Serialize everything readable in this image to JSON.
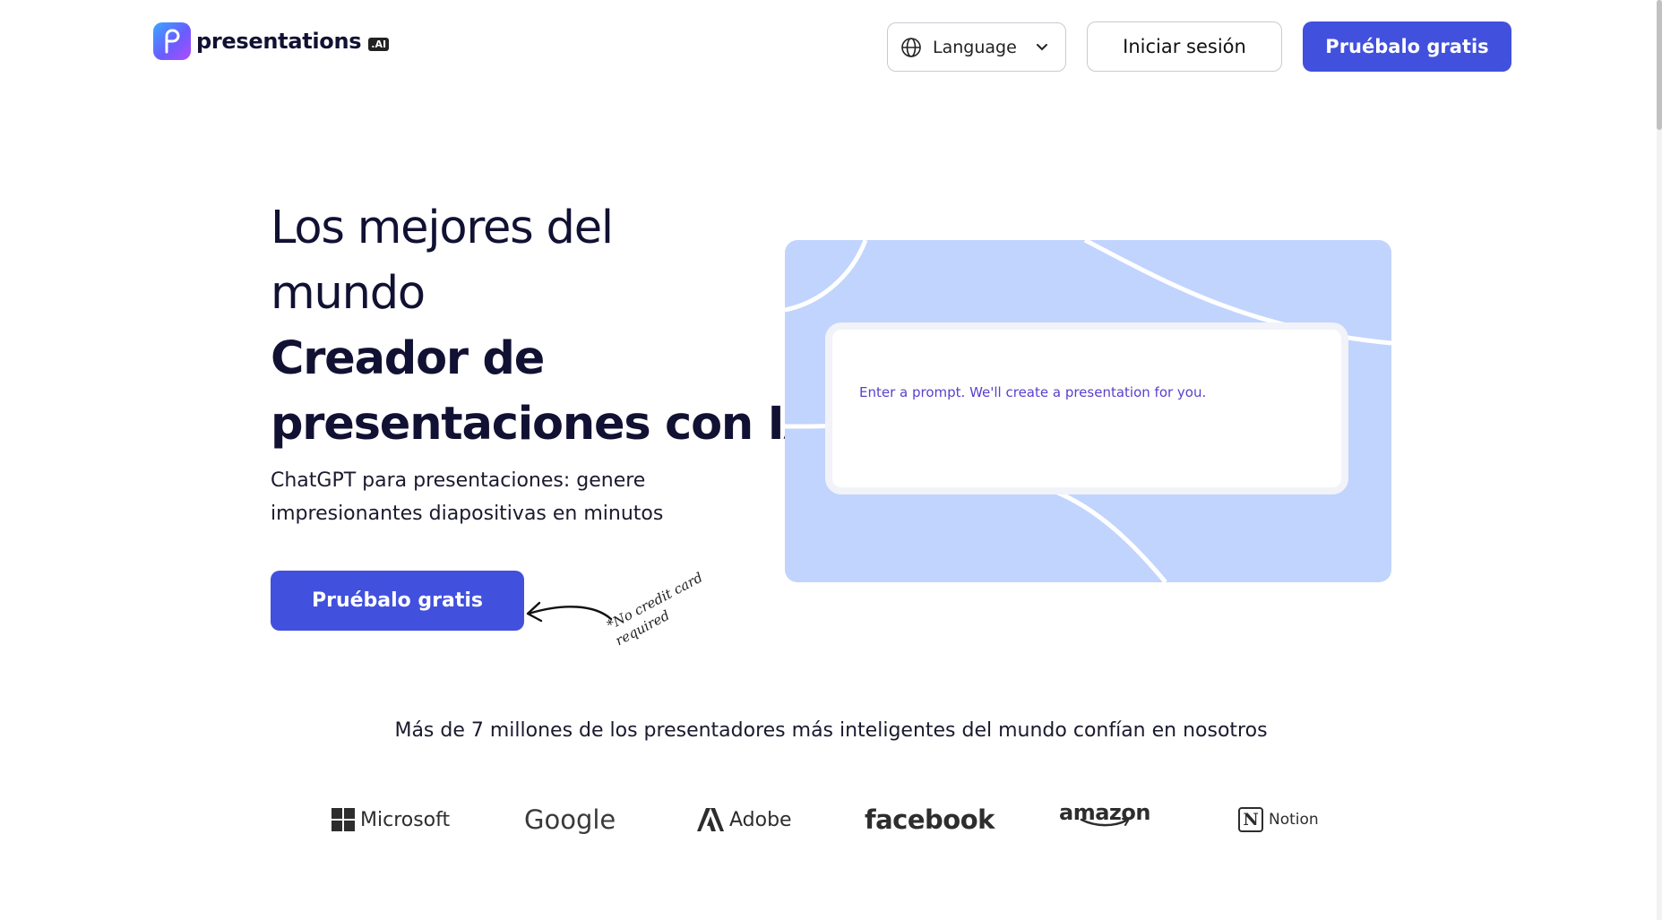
{
  "header": {
    "logo_text": "presentations",
    "logo_badge": ".AI",
    "language_label": "Language",
    "login_label": "Iniciar sesión",
    "try_label": "Pruébalo gratis"
  },
  "hero": {
    "title_lines": [
      "Los mejores del",
      "mundo",
      "Creador de",
      "presentaciones con IA"
    ],
    "subtitle": "ChatGPT para presentaciones: genere impresionantes diapositivas en minutos",
    "cta_label": "Pruébalo gratis",
    "no_credit_card": "*No credit card required"
  },
  "prompt": {
    "placeholder": "Enter a prompt. We'll create a presentation for you."
  },
  "trust": {
    "text": "Más de 7 millones de los presentadores más inteligentes del mundo confían en nosotros",
    "brands": [
      "Microsoft",
      "Google",
      "Adobe",
      "facebook",
      "amazon",
      "Notion"
    ]
  },
  "colors": {
    "accent": "#4150dd",
    "panel_bg": "#c1d4fd",
    "prompt_text": "#5a3fcc"
  }
}
